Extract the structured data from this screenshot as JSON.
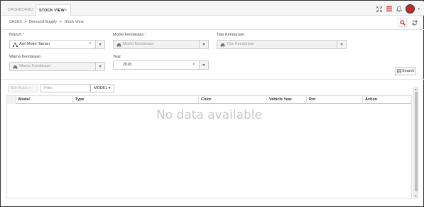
{
  "tabs": [
    {
      "label": "DASHBOARD"
    },
    {
      "label": "STOCK VIEW",
      "close": "×"
    }
  ],
  "breadcrumb": {
    "items": [
      "SALES",
      "Demand Supply",
      "Stock View"
    ],
    "separator": ">"
  },
  "filters": {
    "branch": {
      "label": "Branch",
      "required": "*",
      "value": "Asri Motor Taman"
    },
    "model": {
      "label": "Model Kendaraan",
      "required": "*",
      "placeholder": "Model Kendaraan"
    },
    "tipe": {
      "label": "Tipe Kendaraan",
      "placeholder": "Tipe Kendaraan"
    },
    "warna": {
      "label": "Warna Kendaraan",
      "placeholder": "Warna Kendaraan"
    },
    "year": {
      "label": "Year",
      "value": "2018"
    },
    "clear_symbol": "×"
  },
  "search_button": {
    "label": "Search"
  },
  "toolbar": {
    "bulk_action": "Bulk Action ▾",
    "filter_placeholder": "Filter",
    "model_button": "MODEL ▾"
  },
  "table": {
    "columns": [
      "Model",
      "Type",
      "Color",
      "Vehicle Year",
      "Rrn",
      "Action"
    ],
    "empty_text": "No data available"
  },
  "colors": {
    "accent": "#c62828",
    "required": "#e53935"
  },
  "icons": [
    "expand-icon",
    "menu-icon",
    "bell-icon",
    "avatar",
    "search-icon",
    "refresh-icon",
    "branch-icon",
    "car-icon"
  ]
}
